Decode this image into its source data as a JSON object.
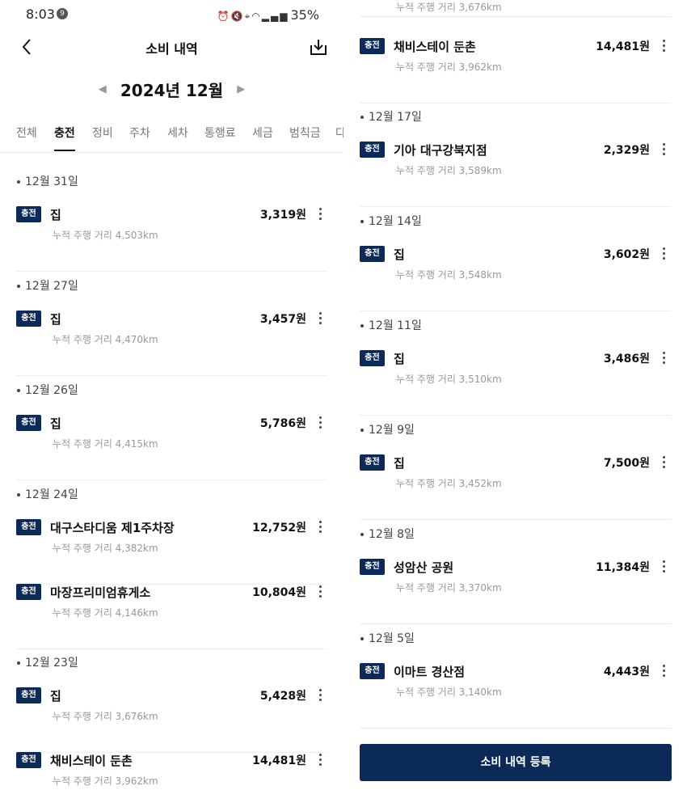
{
  "status_bar": {
    "time": "8:03",
    "notification_count": "9",
    "battery": "35%"
  },
  "header": {
    "title": "소비 내역"
  },
  "month_selector": {
    "label": "2024년 12월"
  },
  "tabs": [
    "전체",
    "충전",
    "정비",
    "주차",
    "세차",
    "통행료",
    "세금",
    "범칙금",
    "다"
  ],
  "active_tab": "충전",
  "left_list": [
    {
      "date": "12월 31일",
      "items": [
        {
          "badge": "충전",
          "name": "집",
          "amount": "3,319원",
          "distance": "누적 주행 거리 4,503km"
        }
      ]
    },
    {
      "date": "12월 27일",
      "items": [
        {
          "badge": "충전",
          "name": "집",
          "amount": "3,457원",
          "distance": "누적 주행 거리 4,470km"
        }
      ]
    },
    {
      "date": "12월 26일",
      "items": [
        {
          "badge": "충전",
          "name": "집",
          "amount": "5,786원",
          "distance": "누적 주행 거리 4,415km"
        }
      ]
    },
    {
      "date": "12월 24일",
      "items": [
        {
          "badge": "충전",
          "name": "대구스타디움 제1주차장",
          "amount": "12,752원",
          "distance": "누적 주행 거리 4,382km"
        },
        {
          "badge": "충전",
          "name": "마장프리미엄휴게소",
          "amount": "10,804원",
          "distance": "누적 주행 거리 4,146km"
        }
      ]
    },
    {
      "date": "12월 23일",
      "items": [
        {
          "badge": "충전",
          "name": "집",
          "amount": "5,428원",
          "distance": "누적 주행 거리 3,676km"
        },
        {
          "badge": "충전",
          "name": "채비스테이 둔촌",
          "amount": "14,481원",
          "distance": "누적 주행 거리 3,962km"
        }
      ]
    }
  ],
  "right_top_cut": "누적 주행 거리 3,676km",
  "right_list": [
    {
      "date": "",
      "items": [
        {
          "badge": "충전",
          "name": "채비스테이 둔촌",
          "amount": "14,481원",
          "distance": "누적 주행 거리 3,962km"
        }
      ]
    },
    {
      "date": "12월 17일",
      "items": [
        {
          "badge": "충전",
          "name": "기아 대구강북지점",
          "amount": "2,329원",
          "distance": "누적 주행 거리 3,589km"
        }
      ]
    },
    {
      "date": "12월 14일",
      "items": [
        {
          "badge": "충전",
          "name": "집",
          "amount": "3,602원",
          "distance": "누적 주행 거리 3,548km"
        }
      ]
    },
    {
      "date": "12월 11일",
      "items": [
        {
          "badge": "충전",
          "name": "집",
          "amount": "3,486원",
          "distance": "누적 주행 거리 3,510km"
        }
      ]
    },
    {
      "date": "12월 9일",
      "items": [
        {
          "badge": "충전",
          "name": "집",
          "amount": "7,500원",
          "distance": "누적 주행 거리 3,452km"
        }
      ]
    },
    {
      "date": "12월 8일",
      "items": [
        {
          "badge": "충전",
          "name": "성암산 공원",
          "amount": "11,384원",
          "distance": "누적 주행 거리 3,370km"
        }
      ]
    },
    {
      "date": "12월 5일",
      "items": [
        {
          "badge": "충전",
          "name": "이마트 경산점",
          "amount": "4,443원",
          "distance": "누적 주행 거리 3,140km"
        }
      ]
    }
  ],
  "cta": {
    "label": "소비 내역 등록"
  },
  "colors": {
    "badge_bg": "#0c2a57",
    "cta_bg": "#0c2a57"
  }
}
